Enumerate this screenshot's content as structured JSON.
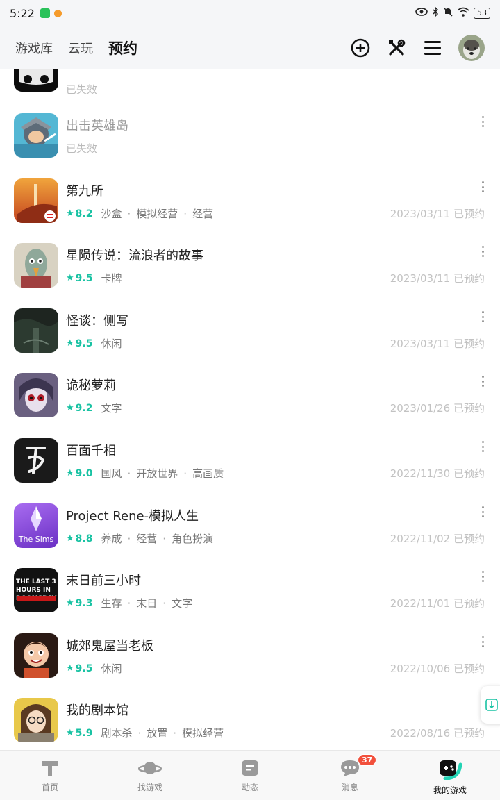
{
  "status_bar": {
    "time": "5:22",
    "battery": "53"
  },
  "header": {
    "tabs": [
      "游戏库",
      "云玩",
      "预约"
    ],
    "active_tab": "预约",
    "icons": [
      "add-circle-icon",
      "tools-icon",
      "menu-icon",
      "avatar"
    ]
  },
  "games": [
    {
      "title": "",
      "expired": true,
      "status": "已失效"
    },
    {
      "title": "出击英雄岛",
      "expired": true,
      "status": "已失效"
    },
    {
      "title": "第九所",
      "rating": "8.2",
      "tags": [
        "沙盒",
        "模拟经营",
        "经营"
      ],
      "date": "2023/03/11 已预约"
    },
    {
      "title": "星陨传说：流浪者的故事",
      "rating": "9.5",
      "tags": [
        "卡牌"
      ],
      "date": "2023/03/11 已预约"
    },
    {
      "title": "怪谈：侧写",
      "rating": "9.5",
      "tags": [
        "休闲"
      ],
      "date": "2023/03/11 已预约"
    },
    {
      "title": "诡秘萝莉",
      "rating": "9.2",
      "tags": [
        "文字"
      ],
      "date": "2023/01/26 已预约"
    },
    {
      "title": "百面千相",
      "rating": "9.0",
      "tags": [
        "国风",
        "开放世界",
        "高画质"
      ],
      "date": "2022/11/30 已预约"
    },
    {
      "title": "Project Rene-模拟人生",
      "rating": "8.8",
      "tags": [
        "养成",
        "经营",
        "角色扮演"
      ],
      "date": "2022/11/02 已预约",
      "icon_text": "The Sims"
    },
    {
      "title": "末日前三小时",
      "rating": "9.3",
      "tags": [
        "生存",
        "末日",
        "文字"
      ],
      "date": "2022/11/01 已预约",
      "icon_text": "THE LAST 3 HOURS IN DOOMSDAY"
    },
    {
      "title": "城郊鬼屋当老板",
      "rating": "9.5",
      "tags": [
        "休闲"
      ],
      "date": "2022/10/06 已预约"
    },
    {
      "title": "我的剧本馆",
      "rating": "5.9",
      "tags": [
        "剧本杀",
        "放置",
        "模拟经营"
      ],
      "date": "2022/08/16 已预约"
    }
  ],
  "bottom_nav": [
    {
      "label": "首页",
      "icon": "home-icon"
    },
    {
      "label": "找游戏",
      "icon": "planet-icon"
    },
    {
      "label": "动态",
      "icon": "feed-icon"
    },
    {
      "label": "消息",
      "icon": "message-icon",
      "badge": "37"
    },
    {
      "label": "我的游戏",
      "icon": "gamepad-icon",
      "active": true
    }
  ],
  "colors": {
    "accent": "#23d3b4",
    "rating": "#19c2a3",
    "badge": "#f2503c"
  }
}
